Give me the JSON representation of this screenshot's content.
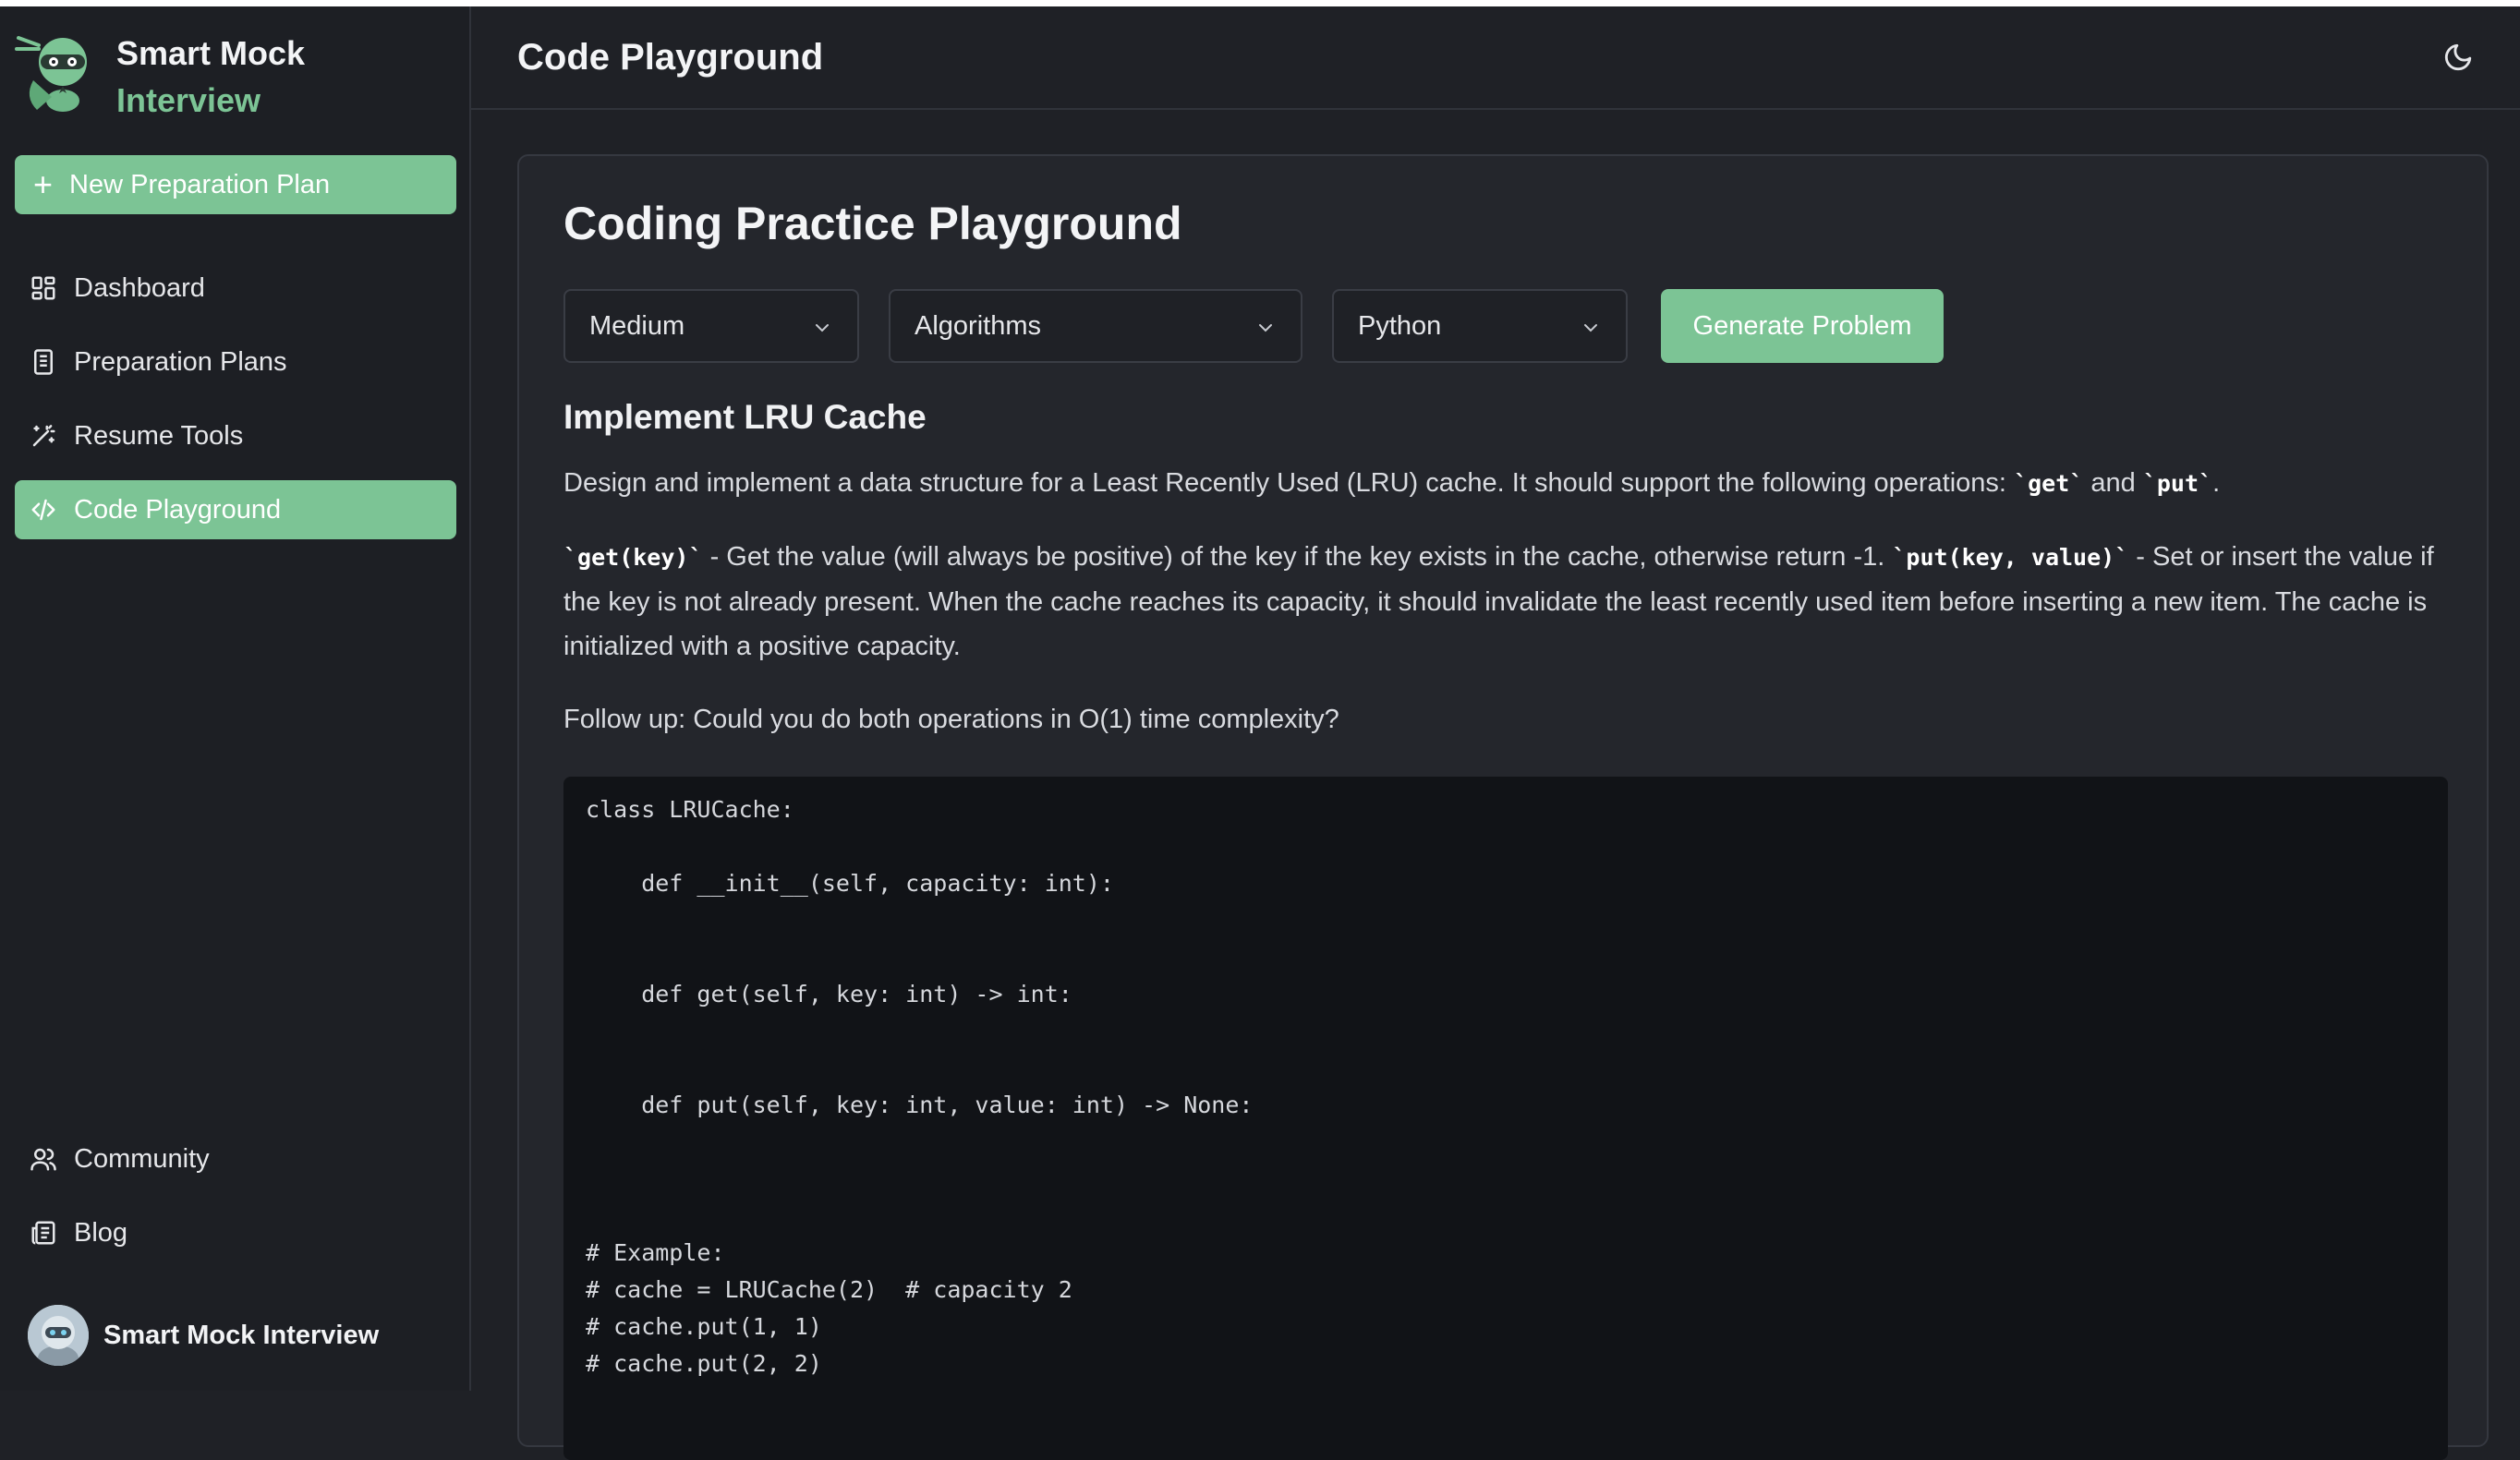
{
  "brand": {
    "name_line1": "Smart Mock",
    "name_line2": "Interview"
  },
  "sidebar": {
    "new_plan_label": "New Preparation Plan",
    "items": [
      {
        "label": "Dashboard",
        "icon": "dashboard-icon"
      },
      {
        "label": "Preparation Plans",
        "icon": "document-icon"
      },
      {
        "label": "Resume Tools",
        "icon": "magic-wand-icon"
      },
      {
        "label": "Code Playground",
        "icon": "code-icon",
        "active": true
      },
      {
        "label": "Community",
        "icon": "users-icon"
      },
      {
        "label": "Blog",
        "icon": "newspaper-icon"
      }
    ],
    "user_name": "Smart Mock Interview"
  },
  "header": {
    "title": "Code Playground",
    "theme_icon": "moon-icon"
  },
  "playground": {
    "heading": "Coding Practice Playground",
    "difficulty": "Medium",
    "topic": "Algorithms",
    "language": "Python",
    "generate_label": "Generate Problem"
  },
  "problem": {
    "title": "Implement LRU Cache",
    "p1_text": "Design and implement a data structure for a Least Recently Used (LRU) cache. It should support the following operations: ",
    "p1_code1": "`get`",
    "p1_and": " and ",
    "p1_code2": "`put`",
    "p1_end": ".",
    "p2_code1": "`get(key)`",
    "p2_text1": " - Get the value (will always be positive) of the key if the key exists in the cache, otherwise return -1. ",
    "p2_code2": "`put(key, value)`",
    "p2_text2": " - Set or insert the value if the key is not already present. When the cache reaches its capacity, it should invalidate the least recently used item before inserting a new item. The cache is initialized with a positive capacity.",
    "p3_text": "Follow up: Could you do both operations in O(1) time complexity?"
  },
  "code": "class LRUCache:\n\n    def __init__(self, capacity: int):\n\n\n    def get(self, key: int) -> int:\n\n\n    def put(self, key: int, value: int) -> None:\n\n\n\n# Example:\n# cache = LRUCache(2)  # capacity 2\n# cache.put(1, 1)\n# cache.put(2, 2)",
  "colors": {
    "accent": "#7cc495",
    "background": "#1f2126",
    "code_bg": "#111317"
  }
}
